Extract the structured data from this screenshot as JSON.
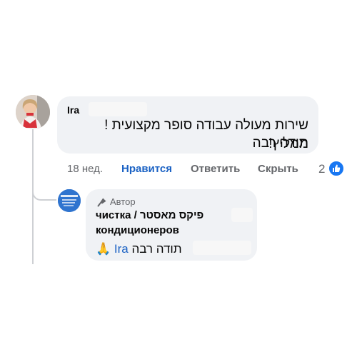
{
  "comment": {
    "author": "Ira",
    "text_line1": "שירות מעולה עבודה סופר מקצועית ! ממליץ!",
    "text_line2": "תודה רבה",
    "time": "18 нед.",
    "like_label": "Нравится",
    "reply_label": "Ответить",
    "hide_label": "Скрыть",
    "reaction_count": "2",
    "reaction_icon": "thumbs-up-icon"
  },
  "reply": {
    "author_badge": "Автор",
    "badge_icon": "microphone-icon",
    "author_name_line1": "чистка / פיקס מאסטר",
    "author_name_line2": "кондиционеров",
    "text": "תודה רבה",
    "mention": "Ira",
    "emoji": "🙏"
  },
  "colors": {
    "bubble": "#f0f2f5",
    "link": "#1b62c4",
    "muted": "#65676b",
    "like_blue": "#1877f2"
  }
}
